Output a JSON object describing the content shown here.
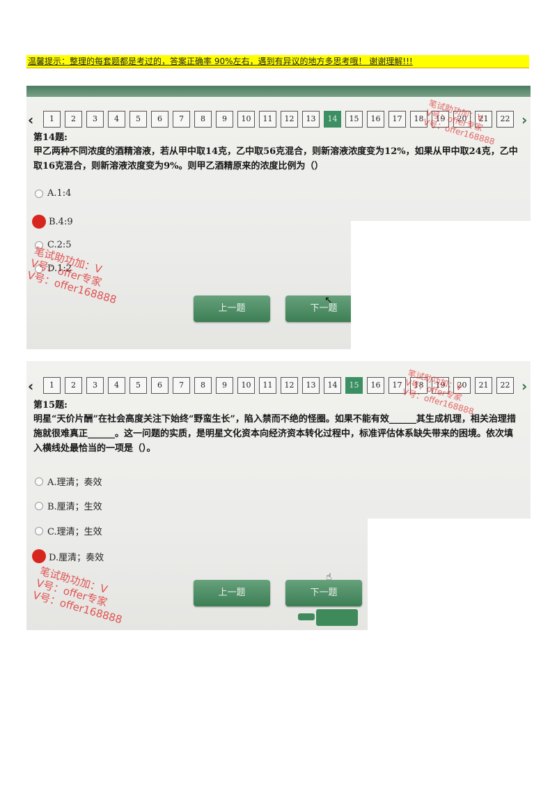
{
  "notice": "温馨提示：整理的每套题都是考过的，答案正确率 90%左右，遇到有异议的地方多思考哦！ 谢谢理解!!!",
  "pages": [
    "1",
    "2",
    "3",
    "4",
    "5",
    "6",
    "7",
    "8",
    "9",
    "10",
    "11",
    "12",
    "13",
    "14",
    "15",
    "16",
    "17",
    "18",
    "19",
    "20",
    "21",
    "22"
  ],
  "arrows": {
    "prev": "‹",
    "next": "›"
  },
  "q1": {
    "title": "第14题:",
    "current_page": "14",
    "body": "甲乙两种不同浓度的酒精溶液，若从甲中取14克，乙中取56克混合，则新溶液浓度变为12%，如果从甲中取24克，乙中取16克混合，则新溶液浓度变为9%。则甲乙酒精原来的浓度比例为（）",
    "options": [
      {
        "label": "A.1:4",
        "selected": false
      },
      {
        "label": "B.4:9",
        "selected": true
      },
      {
        "label": "C.2:5",
        "selected": false
      },
      {
        "label": "D.1:2",
        "selected": false
      }
    ],
    "prev_button": "上一题",
    "next_button": "下一题"
  },
  "q2": {
    "title": "第15题:",
    "current_page": "15",
    "body": "明星“天价片酬”在社会高度关注下始终“野蛮生长”，陷入禁而不绝的怪圈。如果不能有效______其生成机理，相关治理措施就很难真正______。这一问题的实质，是明星文化资本向经济资本转化过程中，标准评估体系缺失带来的困境。依次填入横线处最恰当的一项是（）。",
    "options": [
      {
        "label": "A.理清；奏效",
        "selected": false
      },
      {
        "label": "B.厘清；生效",
        "selected": false
      },
      {
        "label": "C.理清；生效",
        "selected": false
      },
      {
        "label": "D.厘清；奏效",
        "selected": true
      }
    ],
    "prev_button": "上一题",
    "next_button": "下一题"
  },
  "watermark": {
    "line1": "笔试助功加：V",
    "line2": "V号：offer专家",
    "line3": "V号：offer168888"
  },
  "colors": {
    "selected": "#d7261e",
    "current_page": "#3c8e63",
    "button": "#4a8a60",
    "notice_bg": "#ffff00",
    "watermark": "#de2828"
  }
}
